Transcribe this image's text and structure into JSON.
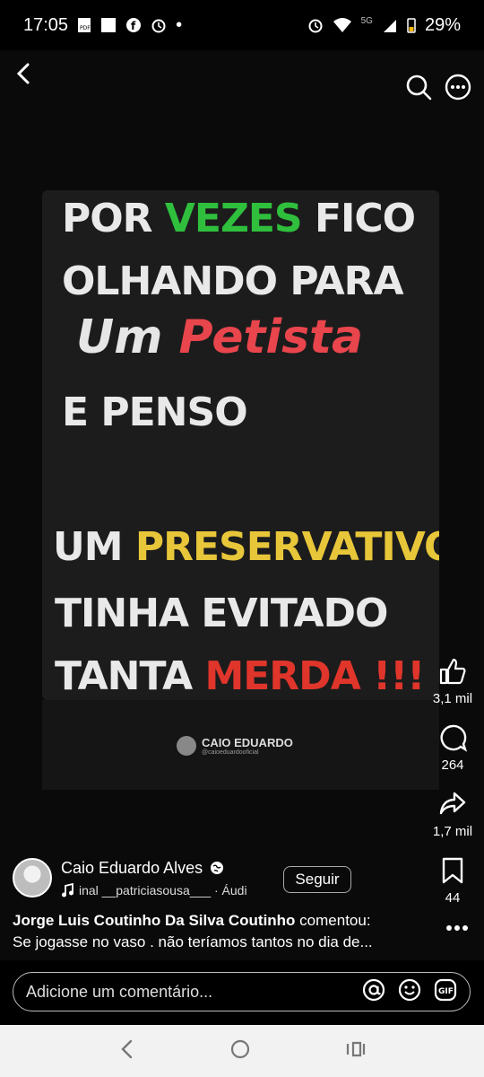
{
  "status": {
    "time": "17:05",
    "network": "5G",
    "battery": "29%"
  },
  "post": {
    "lines": [
      {
        "parts": [
          "POR ",
          "VEZES",
          " FICO"
        ]
      },
      {
        "text": "OLHANDO PARA"
      },
      {
        "parts": [
          "Um ",
          "Petista"
        ]
      },
      {
        "text": "E PENSO"
      },
      {
        "parts": [
          "UM ",
          "PRESERVATIVO"
        ]
      },
      {
        "text": "TINHA EVITADO"
      },
      {
        "parts": [
          "TANTA ",
          "MERDA !!!"
        ]
      }
    ],
    "watermark_name": "CAIO EDUARDO",
    "watermark_handle": "@caioeduardooficial"
  },
  "actions": {
    "likes": "3,1 mil",
    "comments": "264",
    "shares": "1,7 mil",
    "saves": "44"
  },
  "author": {
    "name": "Caio Eduardo Alves",
    "audio": "inal   __patriciasousa___ · Áudi",
    "follow_label": "Seguir"
  },
  "comment_preview": {
    "author": "Jorge Luis Coutinho Da Silva Coutinho",
    "verb": " comentou:",
    "text": "Se jogasse no vaso . não teríamos tantos no dia de..."
  },
  "comment_box": {
    "placeholder": "Adicione um comentário..."
  },
  "colors": {
    "green": "#2fbf3d",
    "yellow": "#e8c63a",
    "red": "#e0352b",
    "script_red": "#e8454c"
  }
}
